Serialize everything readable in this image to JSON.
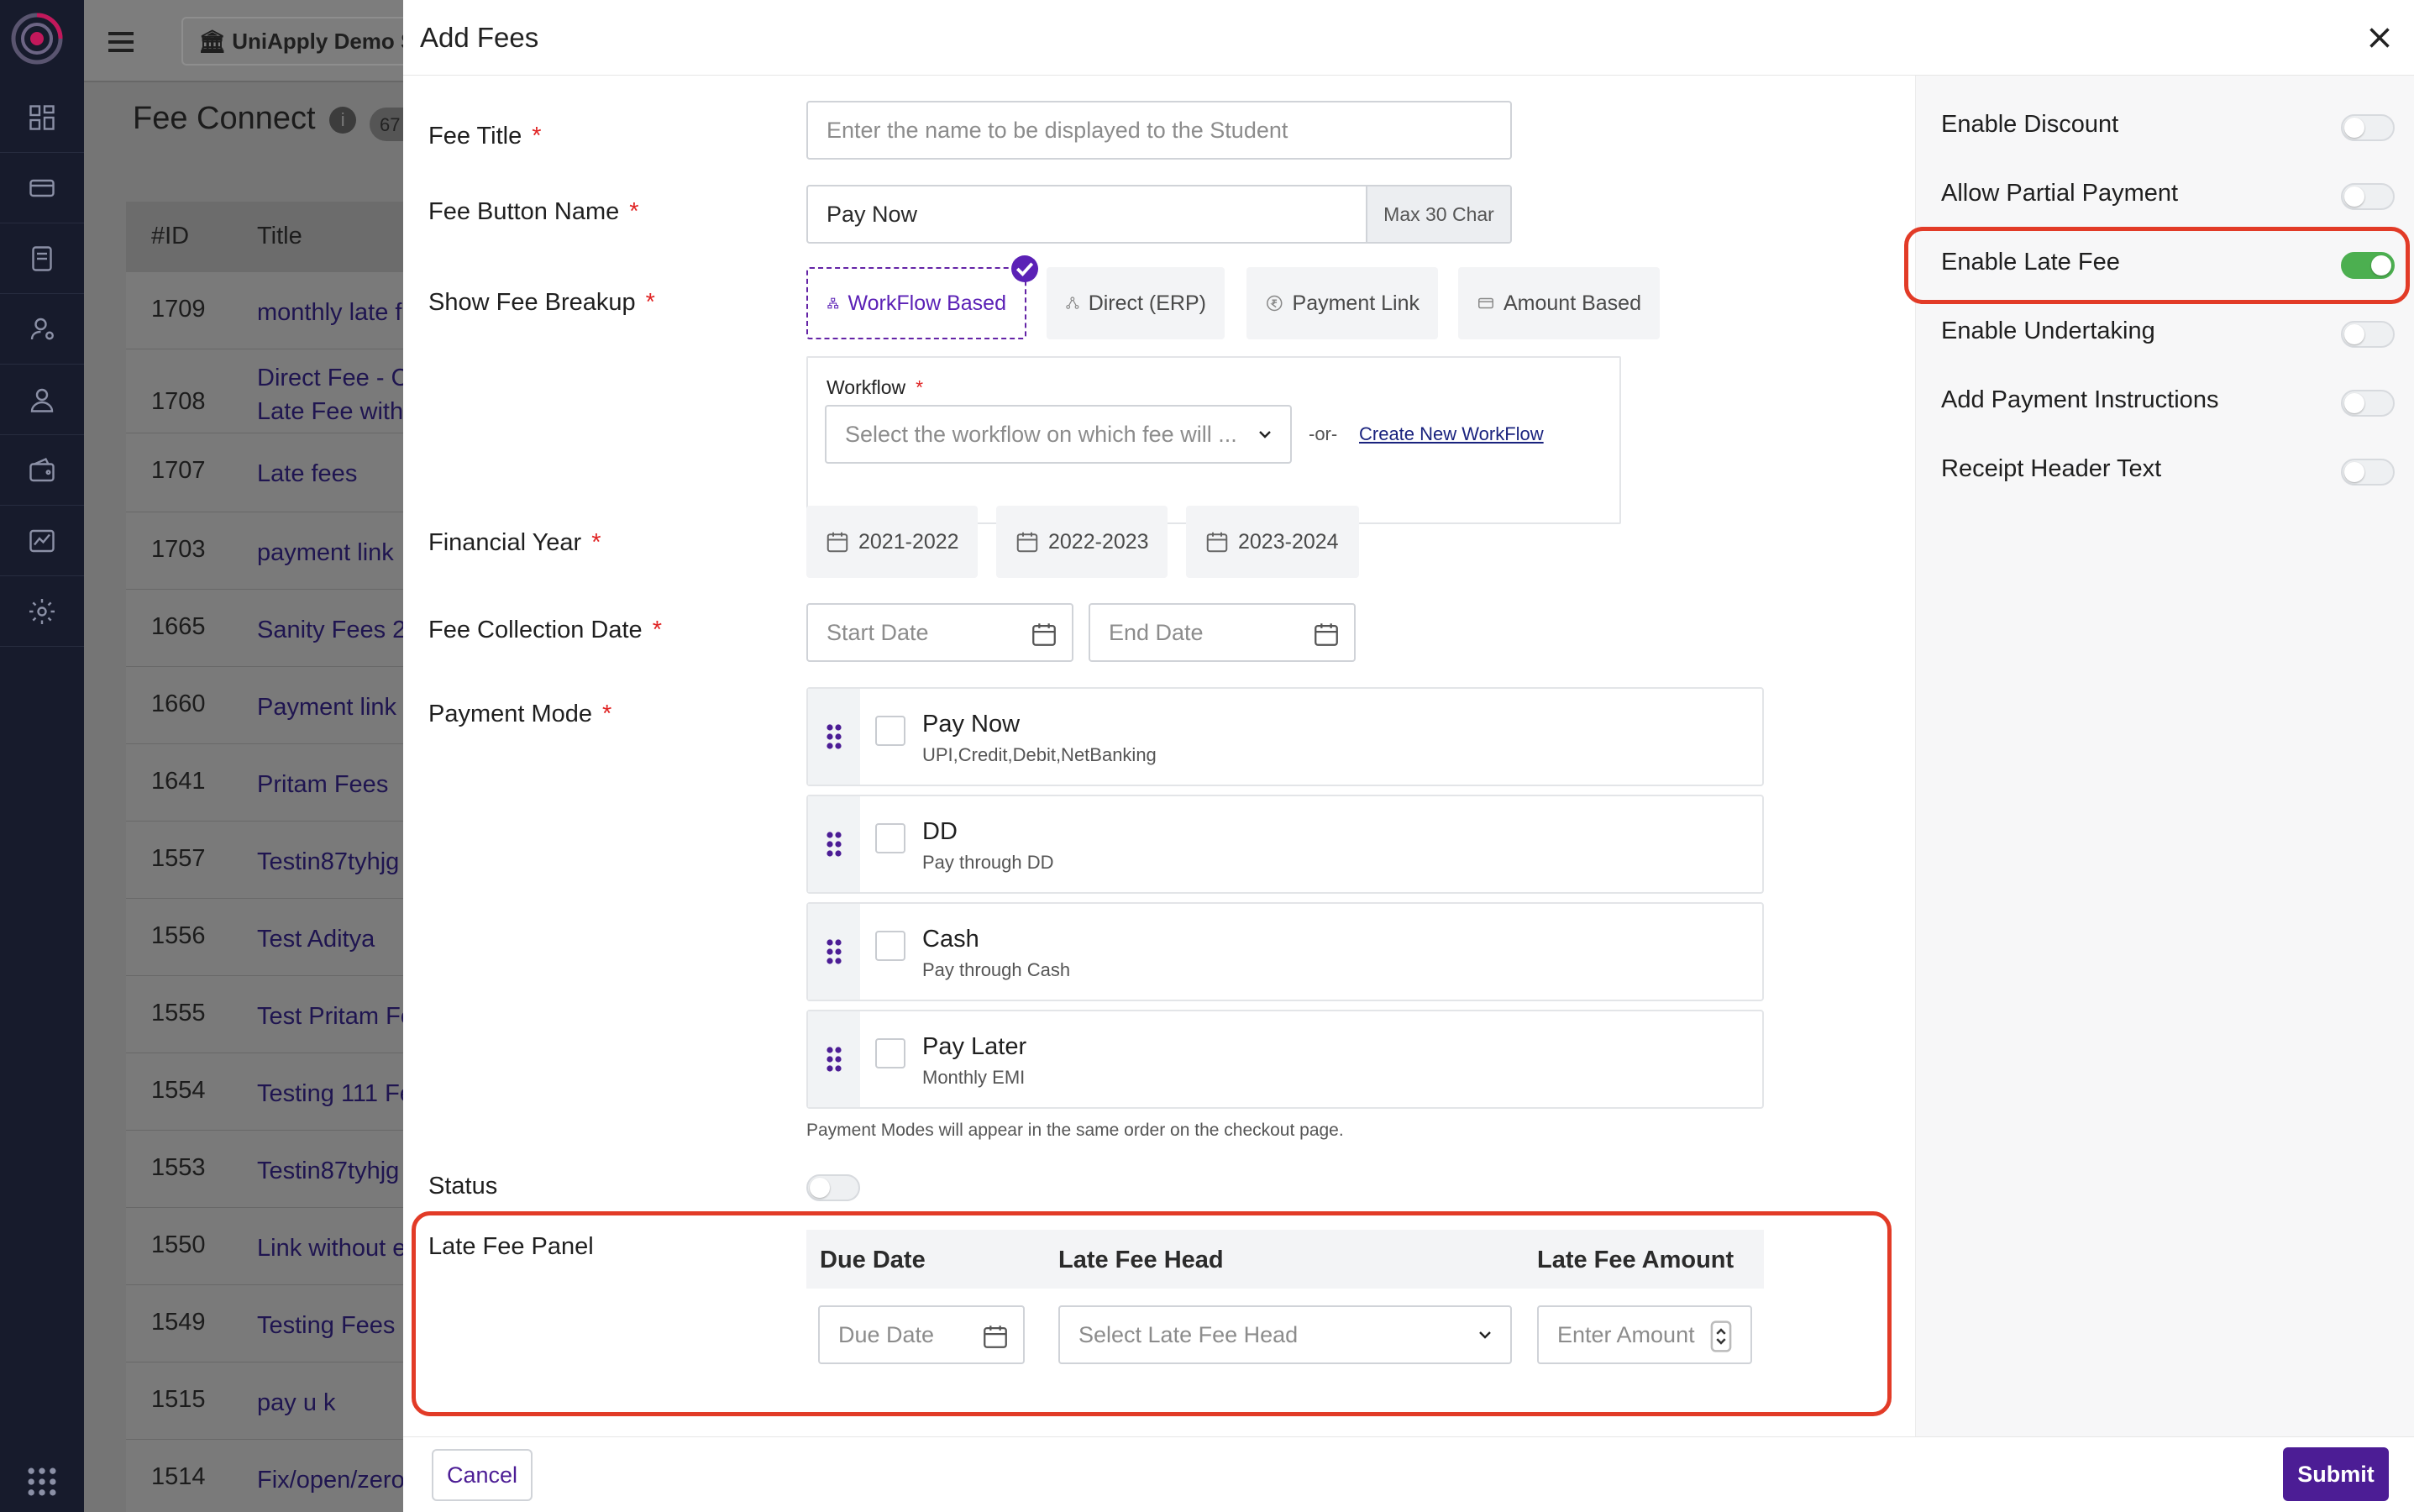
{
  "background": {
    "school_name": "UniApply Demo Sc",
    "page_title": "Fee Connect",
    "count": "67",
    "columns": [
      "#ID",
      "Title"
    ],
    "rows": [
      {
        "id": "1709",
        "title": "monthly late f"
      },
      {
        "id": "1708",
        "title": "Direct Fee - C\nLate Fee with"
      },
      {
        "id": "1707",
        "title": "Late fees"
      },
      {
        "id": "1703",
        "title": "payment link"
      },
      {
        "id": "1665",
        "title": "Sanity Fees 2"
      },
      {
        "id": "1660",
        "title": "Payment link"
      },
      {
        "id": "1641",
        "title": "Pritam Fees"
      },
      {
        "id": "1557",
        "title": "Testin87tyhjg"
      },
      {
        "id": "1556",
        "title": "Test Aditya"
      },
      {
        "id": "1555",
        "title": "Test Pritam Fe"
      },
      {
        "id": "1554",
        "title": "Testing 111 Fe"
      },
      {
        "id": "1553",
        "title": "Testin87tyhjg"
      },
      {
        "id": "1550",
        "title": "Link without e"
      },
      {
        "id": "1549",
        "title": "Testing Fees"
      },
      {
        "id": "1515",
        "title": "pay u k"
      },
      {
        "id": "1514",
        "title": "Fix/open/zero"
      }
    ]
  },
  "modal": {
    "title": "Add Fees",
    "fee_title": {
      "label": "Fee Title",
      "placeholder": "Enter the name to be displayed to the Student"
    },
    "fee_button_name": {
      "label": "Fee Button Name",
      "value": "Pay Now",
      "addon": "Max 30 Char"
    },
    "show_fee_breakup": {
      "label": "Show Fee Breakup",
      "options": [
        "WorkFlow Based",
        "Direct (ERP)",
        "Payment Link",
        "Amount Based"
      ],
      "selected": "WorkFlow Based"
    },
    "workflow": {
      "label": "Workflow",
      "placeholder": "Select the workflow on which fee will ...",
      "or_text": "-or-",
      "create_link": "Create New WorkFlow"
    },
    "financial_year": {
      "label": "Financial Year",
      "options": [
        "2021-2022",
        "2022-2023",
        "2023-2024"
      ]
    },
    "fee_collection_date": {
      "label": "Fee Collection Date",
      "start_placeholder": "Start Date",
      "end_placeholder": "End Date"
    },
    "payment_mode": {
      "label": "Payment Mode",
      "items": [
        {
          "title": "Pay Now",
          "sub": "UPI,Credit,Debit,NetBanking",
          "checked": false
        },
        {
          "title": "DD",
          "sub": "Pay through DD",
          "checked": false
        },
        {
          "title": "Cash",
          "sub": "Pay through Cash",
          "checked": false
        },
        {
          "title": "Pay Later",
          "sub": "Monthly EMI",
          "checked": false
        }
      ],
      "hint": "Payment Modes will appear in the same order on the checkout page."
    },
    "status": {
      "label": "Status",
      "enabled": false
    },
    "late_fee_panel": {
      "label": "Late Fee Panel",
      "columns": [
        "Due Date",
        "Late Fee Head",
        "Late Fee Amount"
      ],
      "due_date_placeholder": "Due Date",
      "head_placeholder": "Select Late Fee Head",
      "amount_placeholder": "Enter Amount"
    },
    "cancel_label": "Cancel",
    "submit_label": "Submit",
    "settings": [
      {
        "label": "Enable Discount",
        "enabled": false
      },
      {
        "label": "Allow Partial Payment",
        "enabled": false
      },
      {
        "label": "Enable Late Fee",
        "enabled": true
      },
      {
        "label": "Enable Undertaking",
        "enabled": false
      },
      {
        "label": "Add Payment Instructions",
        "enabled": false
      },
      {
        "label": "Receipt Header Text",
        "enabled": false
      }
    ]
  },
  "colors": {
    "accent": "#5b21b6",
    "highlight": "#e23b27",
    "toggle_on": "#4caf50",
    "nav_bg": "#171b2c"
  }
}
